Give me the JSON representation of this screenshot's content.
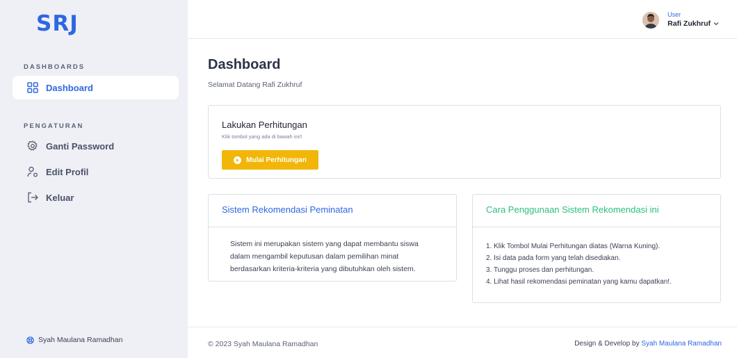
{
  "brand": {
    "logo_text": "SRJ",
    "accent": "#2f67e0"
  },
  "sidebar": {
    "sections": [
      {
        "title": "DASHBOARDS"
      },
      {
        "title": "PENGATURAN"
      }
    ],
    "items": [
      {
        "label": "Dashboard",
        "icon": "grid-icon",
        "active": true
      },
      {
        "label": "Ganti Password",
        "icon": "gear-icon",
        "active": false
      },
      {
        "label": "Edit Profil",
        "icon": "user-icon",
        "active": false
      },
      {
        "label": "Keluar",
        "icon": "logout-icon",
        "active": false
      }
    ],
    "footer_text": "Syah Maulana Ramadhan"
  },
  "topbar": {
    "user_role": "User",
    "user_name": "Rafi Zukhruf"
  },
  "main": {
    "title": "Dashboard",
    "subtitle": "Selamat Datang Rafi Zukhruf",
    "calc_card": {
      "title": "Lakukan Perhitungan",
      "subtitle": "Klik tombol yang ada di bawah ini!!",
      "button_label": "Mulai Perhitungan",
      "button_color": "#f1b608"
    },
    "info_card": {
      "title": "Sistem Rekomendasi Peminatan",
      "body": "Sistem ini merupakan sistem yang dapat membantu siswa dalam mengambil keputusan dalam pemilihan minat berdasarkan kriteria-kriteria yang dibutuhkan oleh sistem."
    },
    "howto_card": {
      "title": "Cara Penggunaan Sistem Rekomendasi ini",
      "title_color": "#2bbf7d",
      "steps": [
        "1. Klik Tombol Mulai Perhitungan diatas (Warna Kuning).",
        "2. Isi data pada form yang telah disediakan.",
        "3. Tunggu proses dan perhitungan.",
        "4. Lihat hasil rekomendasi peminatan yang kamu dapatkan!."
      ]
    }
  },
  "footer": {
    "copyright": "© 2023 Syah Maulana Ramadhan",
    "credit_prefix": "Design & Develop by ",
    "credit_name": "Syah Maulana Ramadhan"
  }
}
